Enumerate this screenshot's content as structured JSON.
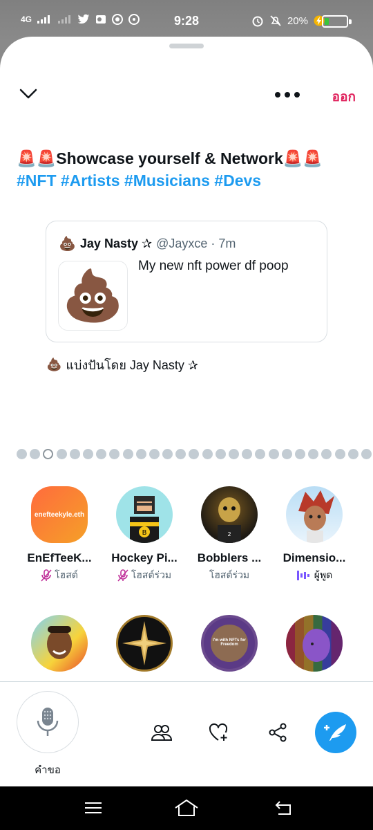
{
  "status_bar": {
    "network": "4G",
    "time": "9:28",
    "battery": "20%",
    "battery_level": 0.2,
    "icons": [
      "signal-icon",
      "twitter-icon",
      "outlook-icon",
      "chrome-icon",
      "browser-icon",
      "alarm-icon",
      "mute-icon",
      "charging-icon"
    ]
  },
  "header": {
    "leave_label": "ออก"
  },
  "space": {
    "title_line1": "🚨🚨Showcase yourself & Network🚨🚨",
    "title_tags": "#NFT #Artists #Musicians #Devs"
  },
  "pinned_tweet": {
    "avatar_emoji": "💩",
    "name": "Jay Nasty ✰",
    "meta": "@Jayxce · 7m",
    "image_emoji": "💩",
    "text": "My new nft power df poop"
  },
  "shared_by": {
    "emoji": "💩",
    "text": "แบ่งปันโดย Jay Nasty ✰"
  },
  "carousel": {
    "total": 27,
    "active_index": 2
  },
  "participants": [
    {
      "name": "EnEfTeeK...",
      "role": "โฮสต์",
      "role_icon": "mic-muted-icon",
      "avatar_text": "enefteekyle.eth",
      "role_type": "muted"
    },
    {
      "name": "Hockey Pi...",
      "role": "โฮสต์ร่วม",
      "role_icon": "mic-muted-icon",
      "role_type": "muted"
    },
    {
      "name": "Bobblers ...",
      "role": "โฮสต์ร่วม",
      "role_icon": "",
      "role_type": "none"
    },
    {
      "name": "Dimensio...",
      "role": "ผู้พูด",
      "role_icon": "speaking-icon",
      "role_type": "speaking"
    },
    {
      "name": "",
      "role": ""
    },
    {
      "name": "",
      "role": ""
    },
    {
      "name": "",
      "role": "",
      "avatar_text": "I'm with NFTs for Freedom"
    },
    {
      "name": "",
      "role": ""
    }
  ],
  "bottom_bar": {
    "mic_label": "คำขอ",
    "actions": [
      "people-icon",
      "heart-plus-icon",
      "share-icon",
      "compose-icon"
    ]
  },
  "colors": {
    "accent": "#1d9bf0",
    "leave": "#e0245e",
    "muted_mic": "#c0309a",
    "speaking": "#7856ff"
  }
}
